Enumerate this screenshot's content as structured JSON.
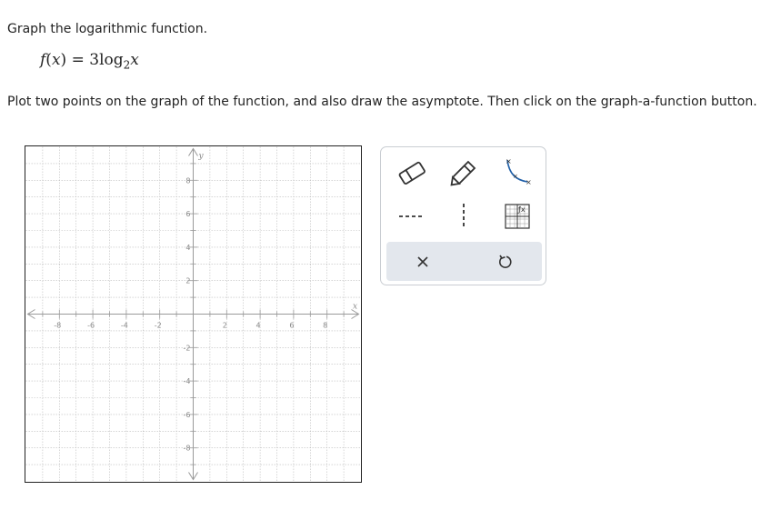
{
  "question": {
    "title": "Graph the logarithmic function.",
    "function_name": "f",
    "variable": "x",
    "equals": "=",
    "coefficient": "3",
    "log_word": "log",
    "log_base": "2",
    "instructions": "Plot two points on the graph of the function, and also draw the asymptote. Then click on the graph-a-function button."
  },
  "graph": {
    "x_axis_label": "x",
    "y_axis_label": "y",
    "x_range": [
      -10,
      10
    ],
    "y_range": [
      -10,
      10
    ],
    "tick_step": 2,
    "grid_step": 1,
    "x_tick_labels": [
      "-8",
      "-6",
      "-4",
      "-2",
      "2",
      "4",
      "6",
      "8"
    ],
    "y_tick_labels": [
      "8",
      "6",
      "4",
      "2",
      "-2",
      "-4",
      "-6",
      "-8"
    ],
    "grid": true
  },
  "toolbox": {
    "tools": [
      {
        "name": "eraser-tool",
        "icon": "eraser-icon"
      },
      {
        "name": "pencil-tool",
        "icon": "pencil-icon"
      },
      {
        "name": "logarithmic-curve-tool",
        "icon": "curve-icon"
      },
      {
        "name": "horizontal-asymptote-tool",
        "icon": "horizontal-dashed-line-icon"
      },
      {
        "name": "vertical-asymptote-tool",
        "icon": "vertical-dashed-line-icon"
      },
      {
        "name": "graph-a-function-tool",
        "icon": "graph-function-icon"
      }
    ],
    "actions": [
      {
        "name": "clear-button",
        "icon": "close-icon"
      },
      {
        "name": "undo-button",
        "icon": "undo-icon"
      }
    ]
  },
  "colors": {
    "axis": "#9a9a9a",
    "grid": "#bdbdbd",
    "accent": "#1f5fa8",
    "toolbar_bg": "#e3e7ed",
    "icon": "#333333"
  }
}
